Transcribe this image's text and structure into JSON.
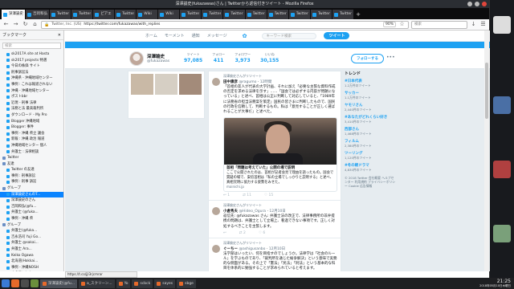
{
  "window": {
    "title": "深澤諭史(fukazawas)さん | Twitterから返信付きツイート - Mozilla Firefox"
  },
  "tabs": [
    {
      "label": "深澤諭史"
    },
    {
      "label": "吉岡和弘"
    },
    {
      "label": "Twitter"
    },
    {
      "label": "Twitter"
    },
    {
      "label": "ピアエ"
    },
    {
      "label": "Twitter"
    },
    {
      "label": "Wiki"
    },
    {
      "label": "Wiki"
    },
    {
      "label": "Twitter"
    },
    {
      "label": "Twitter"
    },
    {
      "label": "Twitter"
    },
    {
      "label": "Twitter"
    },
    {
      "label": "Twitter"
    },
    {
      "label": "Twitter"
    },
    {
      "label": "Twitter"
    },
    {
      "label": "Twitter"
    }
  ],
  "navbar": {
    "site": "Twitter, Inc. (US)",
    "url": "https://twitter.com/fukazawas/with_replies",
    "zoom": "90%",
    "search_placeholder": "検索"
  },
  "sidebar": {
    "title": "ブックマーク",
    "search_placeholder": "検索",
    "items": [
      {
        "label": "sk2017A site at Hasta",
        "folder": false,
        "selected": false
      },
      {
        "label": "sk2017 projects 特選",
        "folder": false,
        "selected": false
      },
      {
        "label": "今日の株価 サイト",
        "folder": false,
        "selected": false
      },
      {
        "label": "刑事訴訟法",
        "folder": false,
        "selected": false
      },
      {
        "label": "沖縄県 - 沖縄地域センター",
        "folder": false,
        "selected": false
      },
      {
        "label": "事例 : これは報道されない",
        "folder": false,
        "selected": false
      },
      {
        "label": "沖縄 - 沖縄地域センター",
        "folder": false,
        "selected": false
      },
      {
        "label": "ポストbbr",
        "folder": false,
        "selected": false
      },
      {
        "label": "近現 - 刑事 法律",
        "folder": false,
        "selected": false
      },
      {
        "label": "法務と法 最高裁判所",
        "folder": false,
        "selected": false
      },
      {
        "label": "ダウンロード - My Pro",
        "folder": false,
        "selected": false
      },
      {
        "label": "Blogger 沖縄地域",
        "folder": false,
        "selected": false
      },
      {
        "label": "Blogger: 事件",
        "folder": false,
        "selected": false
      },
      {
        "label": "事例 - 沖縄 県立 議会",
        "folder": false,
        "selected": false
      },
      {
        "label": "新報 : 沖縄 政治 報道",
        "folder": false,
        "selected": false
      },
      {
        "label": "沖縄地域センター 個人",
        "folder": false,
        "selected": false
      },
      {
        "label": "弁護士 : 法律相談",
        "folder": false,
        "selected": false
      },
      {
        "label": "Twitter",
        "folder": true,
        "selected": false
      },
      {
        "label": "友達",
        "folder": true,
        "selected": false
      },
      {
        "label": "Twitter の友達",
        "folder": false,
        "selected": false
      },
      {
        "label": "事例 : 刑事訴訟",
        "folder": false,
        "selected": false
      },
      {
        "label": "事例 : 刑事 訴訟",
        "folder": false,
        "selected": false
      },
      {
        "label": "グループ",
        "folder": true,
        "selected": false
      },
      {
        "label": "深澤諭史さんのT...",
        "folder": false,
        "selected": true
      },
      {
        "label": "深澤諭史のさん",
        "folder": false,
        "selected": false
      },
      {
        "label": "吉岡和弘(@fu...",
        "folder": false,
        "selected": false
      },
      {
        "label": "弁護士 (@fuka...",
        "folder": false,
        "selected": false
      },
      {
        "label": "事例 - 沖縄 県",
        "folder": false,
        "selected": false
      },
      {
        "label": "グループ",
        "folder": true,
        "selected": false
      },
      {
        "label": "弁護士(@fuka...",
        "folder": false,
        "selected": false
      },
      {
        "label": "吉永浩司 Yuji Go...",
        "folder": false,
        "selected": false
      },
      {
        "label": "弁護士 @sakai...",
        "folder": false,
        "selected": false
      },
      {
        "label": "弁護士 Ara...",
        "folder": false,
        "selected": false
      },
      {
        "label": "Keiko Ogawa",
        "folder": false,
        "selected": false
      },
      {
        "label": "北海道(Hokkai...",
        "folder": false,
        "selected": false
      },
      {
        "label": "事例 - 沖縄NOSH",
        "folder": false,
        "selected": false
      },
      {
        "label": "くまモン(@kumamon",
        "folder": false,
        "selected": false
      }
    ]
  },
  "twitter_nav": {
    "home": "ホーム",
    "moments": "モーメント",
    "notifications": "通知",
    "messages": "メッセージ",
    "search_placeholder": "キーワード検索",
    "tweet_button": "ツイート"
  },
  "profile": {
    "name": "深澤諭史",
    "handle": "@fukazawas",
    "stats": [
      {
        "label": "ツイート",
        "value": "97,085"
      },
      {
        "label": "フォロー",
        "value": "411"
      },
      {
        "label": "フォロワー",
        "value": "3,973"
      },
      {
        "label": "いいね",
        "value": "30,155"
      }
    ],
    "follow_button": "フォローする",
    "more": "•••"
  },
  "tweets": [
    {
      "context": "深澤諭史さんがリツイート",
      "name": "田中康彦",
      "handle": "@ragumo",
      "time": "12時間",
      "text": "「首相の友人が代表の大学計画、それに加え「必要な主張な資料作成の否定を求める法律を示す」……「国会では必ずする内容が問題になっている」と述べ、首相は公正に判断して対応していると、「1989年に法務省の担当法務案を策定」国民の皆さまに判断したもので、国民の行政を信頼して、判断するもの。私は「意見することが正しく選ばれることが大事だ」と述べた。",
      "card_title": "首相「問題は考えていた」公開の場で説明",
      "card_desc": "ここで公開されたのは、首相が記者会見で理由を語ったもの。国会で質疑の場で、安倍首相は「私の立場でしっかりと説明する」と述べ、真相究明に協力する姿勢をみせた。",
      "card_domain": "mainichi.jp",
      "actions": [
        "1",
        "11",
        "15"
      ]
    },
    {
      "context": "深澤諭史さんがリツイート",
      "name": "小倉秀夫",
      "handle": "@Hideo_Ogura",
      "time": "12月10日",
      "text": "返信先: @fukazawas さん: 弁護士法の改正で、法律事務所の非弁提携の問題は、弁護士として立場上、看過できない事項です。正しく対処するべきことを主張します。",
      "actions": [
        "",
        "2",
        "6"
      ]
    },
    {
      "context": "深澤諭史さんがリツイート",
      "name": "ぐーちー",
      "handle": "@ashigusanbo",
      "time": "12月10日",
      "text": "法学部はいったい、何を目指すのでしょうか。法律学は「社会のルール」を学ぶものであり、「裁判所を通じた紛争解決」という意味で実務的な側面がある。その上で「憲法」「民法」「刑法」という基本的な科目を体系的に勉強することが求められていると考えます。",
      "actions": [
        "1",
        "3",
        "9"
      ]
    }
  ],
  "sidebar_right": {
    "title": "トレンド",
    "trends": [
      {
        "name": "#日本代表",
        "count": "1.2万件のツイート"
      },
      {
        "name": "サッカー",
        "count": "1.1万件のツイート"
      },
      {
        "name": "ヤモリさん",
        "count": "2,440件のツイート"
      },
      {
        "name": "#あなたがどれくらい好き",
        "count": "3,410件のツイート"
      },
      {
        "name": "西部さん",
        "count": "1,468件のツイート"
      },
      {
        "name": "フィルム",
        "count": "2,380件のツイート"
      },
      {
        "name": "ツーリング",
        "count": "1,120件のツイート"
      },
      {
        "name": "#冬の朝ドラマ",
        "count": "4,830件のツイート"
      }
    ],
    "footer": "© 2018 Twitter 会社概要 ヘルプセンター 利用規約 プライバシーポリシー Cookie 広告情報"
  },
  "statusbar": {
    "text": "https://t.co/jjI3rjcmrar"
  },
  "taskbar": {
    "tasks": [
      {
        "label": "深澤諭史(@fu...",
        "active": true
      },
      {
        "label": "a_スクリーン...",
        "active": false
      },
      {
        "label": "Yo",
        "active": false
      },
      {
        "label": "scbck",
        "active": false
      },
      {
        "label": "sayes",
        "active": false
      },
      {
        "label": "sbge",
        "active": false
      }
    ],
    "time": "21:25",
    "date": "2018年05月10日木曜日"
  }
}
